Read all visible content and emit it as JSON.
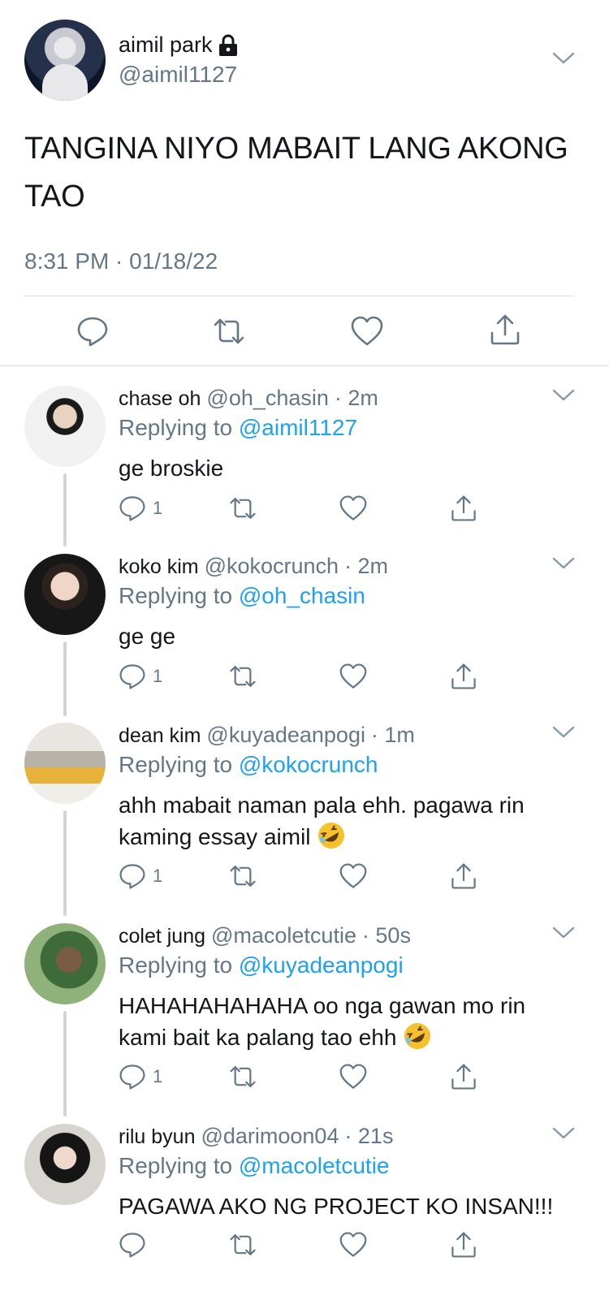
{
  "tweet": {
    "name": "aimil park",
    "handle": "@aimil1127",
    "text": "TANGINA NIYO MABAIT LANG AKONG TAO",
    "timestamp": "8:31 PM · 01/18/22",
    "actions": [
      "reply-icon",
      "retweet-icon",
      "like-icon",
      "share-icon"
    ]
  },
  "replies": [
    {
      "name": "chase oh",
      "handle": "@oh_chasin",
      "time": "· 2m",
      "replying_prefix": "Replying to",
      "replying_to": "@aimil1127",
      "text": "ge broskie",
      "reply_count": "1"
    },
    {
      "name": "koko kim",
      "handle": "@kokocrunch",
      "time": "· 2m",
      "replying_prefix": "Replying to",
      "replying_to": "@oh_chasin",
      "text": "ge ge",
      "reply_count": "1"
    },
    {
      "name": "dean kim",
      "handle": "@kuyadeanpogi",
      "time": "· 1m",
      "replying_prefix": "Replying to",
      "replying_to": "@kokocrunch",
      "text": "ahh mabait naman pala ehh. pagawa rin kaming essay aimil",
      "reply_count": "1",
      "emoji": "rolling-on-floor-laughing"
    },
    {
      "name": "colet jung",
      "handle": "@macoletcutie",
      "time": "· 50s",
      "replying_prefix": "Replying to",
      "replying_to": "@kuyadeanpogi",
      "text": "HAHAHAHAHAHA oo nga gawan mo rin kami bait ka palang tao ehh",
      "reply_count": "1",
      "emoji": "rolling-on-floor-laughing"
    },
    {
      "name": "rilu byun",
      "handle": "@darimoon04",
      "time": "· 21s",
      "replying_prefix": "Replying to",
      "replying_to": "@macoletcutie",
      "text": "PAGAWA AKO NG PROJECT KO INSAN!!!",
      "reply_count": ""
    }
  ],
  "colors": {
    "link": "#1da1f2",
    "secondary": "#657786",
    "text": "#14171a",
    "divider": "#d9dee2"
  }
}
